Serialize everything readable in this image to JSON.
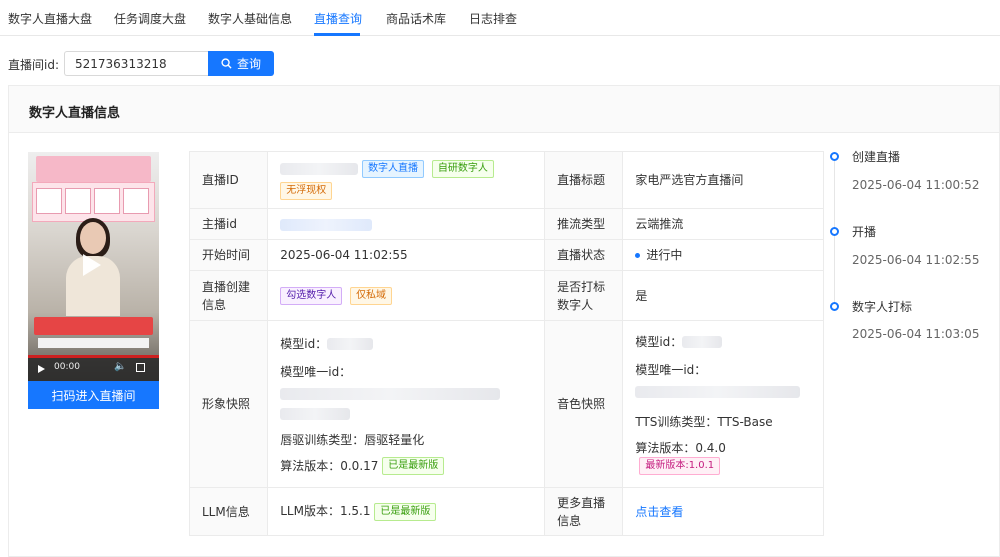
{
  "tabs": [
    "数字人直播大盘",
    "任务调度大盘",
    "数字人基础信息",
    "直播查询",
    "商品话术库",
    "日志排查"
  ],
  "active_tab": "直播查询",
  "search": {
    "label": "直播间id:",
    "value": "521736313218",
    "button": "查询"
  },
  "card": {
    "title": "数字人直播信息"
  },
  "video": {
    "time": "00:00",
    "scan_button": "扫码进入直播间"
  },
  "rows": {
    "live_id": {
      "label": "直播ID",
      "tags": [
        "数字人直播",
        "自研数字人",
        "无浮现权"
      ]
    },
    "title": {
      "label": "直播标题",
      "value": "家电严选官方直播间"
    },
    "anchor": {
      "label": "主播id"
    },
    "push_type": {
      "label": "推流类型",
      "value": "云端推流"
    },
    "start_time": {
      "label": "开始时间",
      "value": "2025-06-04 11:02:55"
    },
    "status": {
      "label": "直播状态",
      "value": "进行中"
    },
    "create_info": {
      "label": "直播创建信息",
      "tags": [
        "勾选数字人",
        "仅私域"
      ]
    },
    "is_marked": {
      "label": "是否打标数字人",
      "value": "是"
    },
    "appearance": {
      "label": "形象快照",
      "model_id": "模型id：",
      "model_uid": "模型唯一id：",
      "driver_type": "唇驱训练类型：唇驱轻量化",
      "algo_version": "算法版本：0.0.17",
      "latest_tag": "已是最新版"
    },
    "voice": {
      "label": "音色快照",
      "model_id": "模型id：",
      "model_uid": "模型唯一id：",
      "tts_type": "TTS训练类型：TTS-Base",
      "algo_version": "算法版本：0.4.0",
      "latest_tag": "最新版本:1.0.1"
    },
    "llm": {
      "label": "LLM信息",
      "version": "LLM版本：1.5.1",
      "latest_tag": "已是最新版"
    },
    "more": {
      "label": "更多直播信息",
      "link": "点击查看"
    }
  },
  "timeline": [
    {
      "label": "创建直播",
      "time": "2025-06-04 11:00:52"
    },
    {
      "label": "开播",
      "time": "2025-06-04 11:02:55"
    },
    {
      "label": "数字人打标",
      "time": "2025-06-04 11:03:05"
    }
  ],
  "colors": {
    "accent": "#1677ff"
  }
}
